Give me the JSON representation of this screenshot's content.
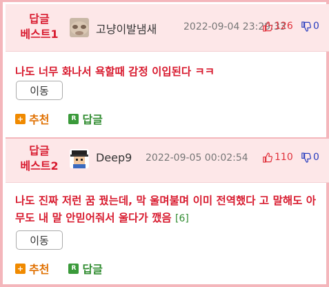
{
  "replies": [
    {
      "best_label_1": "답글",
      "best_label_2": "베스트1",
      "nickname": "고냥이발냄새",
      "datetime": "2022-09-04 23:29:33",
      "upvotes": "126",
      "downvotes": "0",
      "text": "나도 너무 화나서 욕할때 감정 이입된다 ㅋㅋ",
      "count": "",
      "move_label": "이동",
      "recommend_label": "추천",
      "reply_label": "답글"
    },
    {
      "best_label_1": "답글",
      "best_label_2": "베스트2",
      "nickname": "Deep9",
      "datetime": "2022-09-05 00:02:54",
      "upvotes": "110",
      "downvotes": "0",
      "text": "나도 진짜 저런 꿈 꿨는데, 막 울며불며 이미 전역했다 고 말해도 아무도 내 말 안믿어줘서 울다가 깼음",
      "count": "[6]",
      "move_label": "이동",
      "recommend_label": "추천",
      "reply_label": "답글"
    }
  ],
  "icons": {
    "thumb_up": "thumbs-up-icon",
    "thumb_down": "thumbs-down-icon",
    "plus": "plus-square-icon",
    "reply": "r-square-icon"
  },
  "colors": {
    "accent_red": "#d81b2f",
    "header_bg": "#fde7e8",
    "border": "#f4b6bb",
    "recommend": "#e07000",
    "reply": "#2e8b2e",
    "down": "#2a3fbf"
  }
}
